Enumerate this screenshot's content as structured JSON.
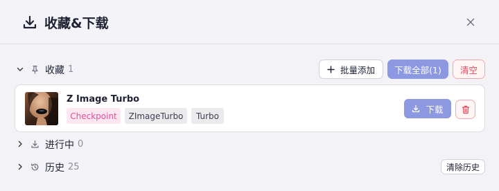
{
  "header": {
    "title": "收藏&下载",
    "icon": "download-icon",
    "close_icon": "close-icon"
  },
  "favorites": {
    "label": "收藏",
    "count": "1",
    "batch_add_label": "批量添加",
    "download_all_label": "下载全部(1)",
    "clear_label": "清空",
    "items": [
      {
        "name": "Z Image Turbo",
        "tags": [
          "Checkpoint",
          "ZImageTurbo",
          "Turbo"
        ],
        "download_label": "下载"
      }
    ]
  },
  "in_progress": {
    "label": "进行中",
    "count": "0"
  },
  "history": {
    "label": "历史",
    "count": "25",
    "clear_history_label": "清除历史"
  },
  "colors": {
    "primary": "#8c98e0",
    "danger": "#e0485a",
    "checkpoint_tag": "#e2509a"
  }
}
